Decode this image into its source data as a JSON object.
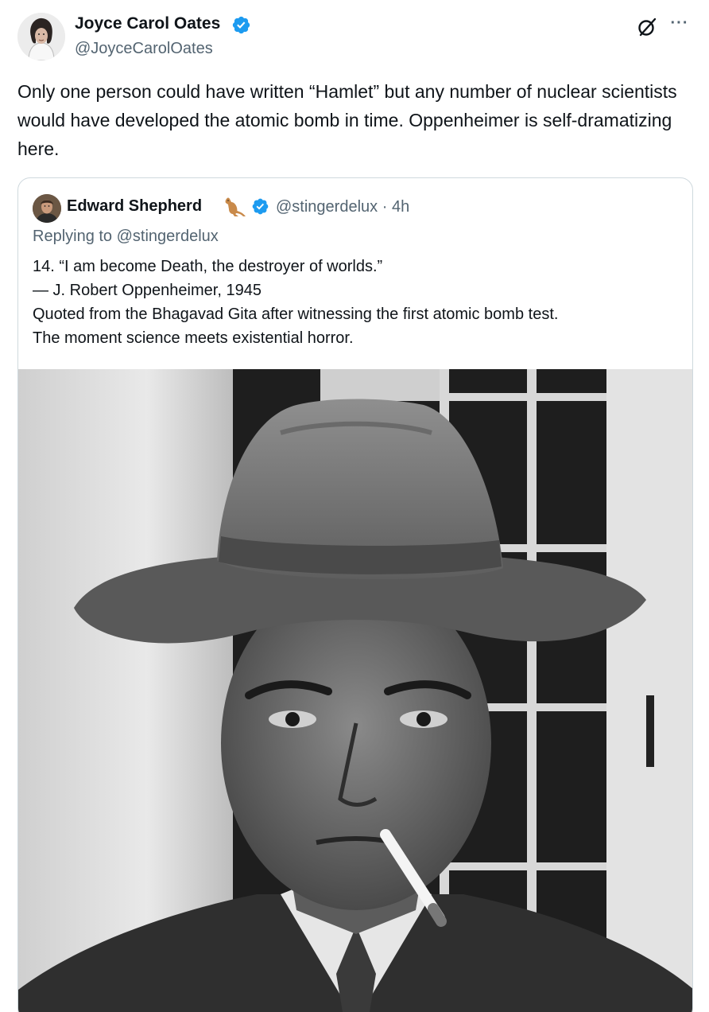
{
  "author": {
    "name": "Joyce Carol Oates",
    "handle": "@JoyceCarolOates"
  },
  "tweet": {
    "text": "Only one person could have written “Hamlet” but any number of nuclear scientists would have developed the atomic bomb in time. Oppenheimer is self-dramatizing here."
  },
  "quote": {
    "author": {
      "name": "Edward Shepherd",
      "handle": "@stingerdelux",
      "separator": "·",
      "time": "4h"
    },
    "replying_to": "Replying to @stingerdelux",
    "lines": [
      "14. “I am become Death, the destroyer of worlds.”",
      "— J. Robert Oppenheimer, 1945",
      "Quoted from the Bhagavad Gita after witnessing the first atomic bomb test.",
      "The moment science meets existential horror."
    ]
  },
  "icons": {
    "verified": "verified-badge-icon",
    "grok": "grok-icon",
    "more": "more-options-icon",
    "kangaroo": "kangaroo-emoji-icon"
  },
  "colors": {
    "verified_blue": "#1d9bf0",
    "secondary_text": "#536471",
    "primary_text": "#0f1419",
    "border": "#cfd9de"
  }
}
